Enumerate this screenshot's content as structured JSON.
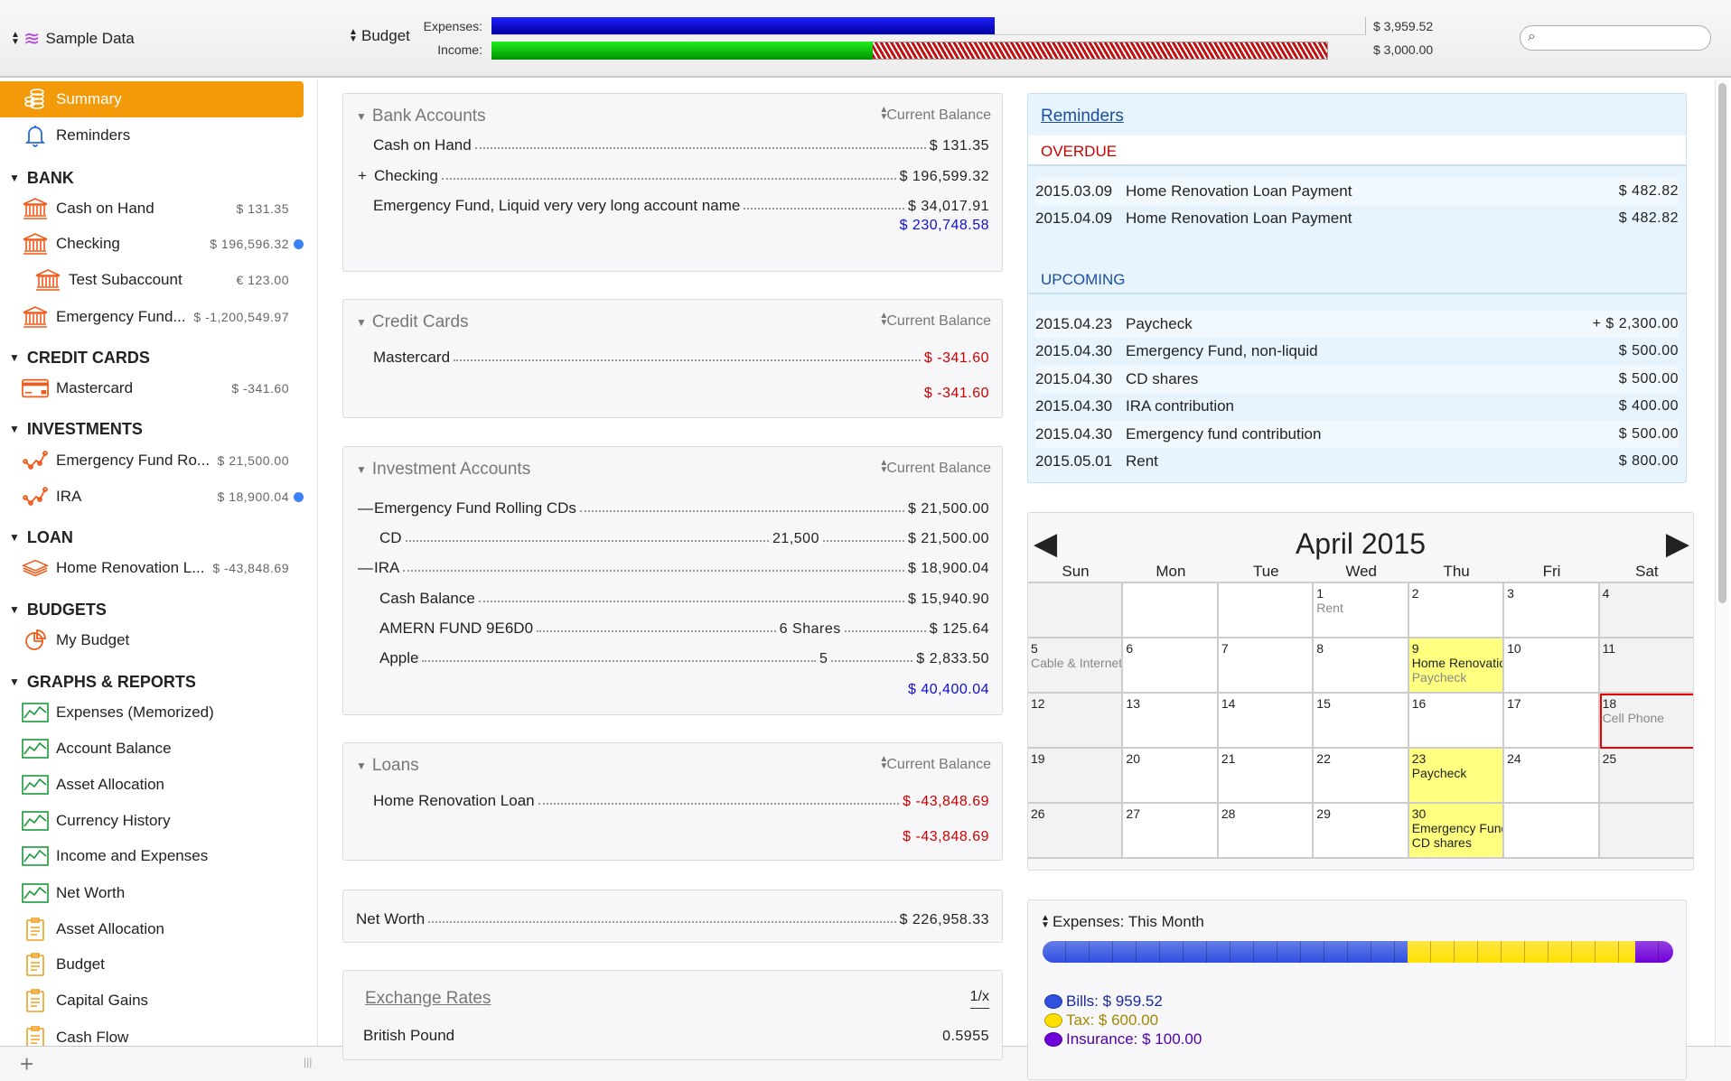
{
  "toolbar": {
    "document": "Sample Data",
    "budget": "Budget",
    "expenses_label": "Expenses:",
    "income_label": "Income:",
    "expenses_value": "$ 3,959.52",
    "income_value": "$ 3,000.00",
    "expenses_fill": 0.576,
    "income_received_fill": 0.436,
    "income_budget_fill": 0.957,
    "search_placeholder": ""
  },
  "colors": {
    "accent": "#f39a0a",
    "expenses_bar": "#0000d8",
    "income_bar": "#10c010",
    "income_remaining": "#c01010",
    "positive_total": "#1010d0",
    "negative": "#cc0000",
    "bills": "#3050e0",
    "tax": "#ffe000",
    "insurance": "#7000d8"
  },
  "sidebar": {
    "items": [
      {
        "label": "Summary",
        "icon": "coins-icon",
        "selected": true
      },
      {
        "label": "Reminders",
        "icon": "bell-icon"
      },
      {
        "label": "BANK",
        "header": true
      },
      {
        "label": "Cash on Hand",
        "icon": "bank-icon",
        "value": "$ 131.35"
      },
      {
        "label": "Checking",
        "icon": "bank-icon",
        "value": "$ 196,596.32",
        "dot": true
      },
      {
        "label": "Test Subaccount",
        "icon": "bank-icon",
        "value": "€ 123.00",
        "indent": true
      },
      {
        "label": "Emergency Fund...",
        "icon": "bank-icon",
        "value": "$ -1,200,549.97"
      },
      {
        "label": "CREDIT CARDS",
        "header": true
      },
      {
        "label": "Mastercard",
        "icon": "credit-card-icon",
        "value": "$ -341.60"
      },
      {
        "label": "INVESTMENTS",
        "header": true
      },
      {
        "label": "Emergency Fund Ro...",
        "icon": "investment-chart-icon",
        "value": "$ 21,500.00"
      },
      {
        "label": "IRA",
        "icon": "investment-chart-icon",
        "value": "$ 18,900.04",
        "dot": true
      },
      {
        "label": "LOAN",
        "header": true
      },
      {
        "label": "Home Renovation L...",
        "icon": "loan-stack-icon",
        "value": "$ -43,848.69"
      },
      {
        "label": "BUDGETS",
        "header": true
      },
      {
        "label": "My Budget",
        "icon": "budget-pie-icon"
      },
      {
        "label": "GRAPHS & REPORTS",
        "header": true
      },
      {
        "label": "Expenses (Memorized)",
        "icon": "graph-icon"
      },
      {
        "label": "Account Balance",
        "icon": "graph-icon"
      },
      {
        "label": "Asset Allocation",
        "icon": "graph-icon"
      },
      {
        "label": "Currency History",
        "icon": "graph-icon"
      },
      {
        "label": "Income and Expenses",
        "icon": "graph-icon"
      },
      {
        "label": "Net Worth",
        "icon": "graph-icon"
      },
      {
        "label": "Asset Allocation",
        "icon": "report-icon"
      },
      {
        "label": "Budget",
        "icon": "report-icon"
      },
      {
        "label": "Capital Gains",
        "icon": "report-icon"
      },
      {
        "label": "Cash Flow",
        "icon": "report-icon"
      }
    ]
  },
  "panels": {
    "bank": {
      "title": "Bank Accounts",
      "column": "Current Balance",
      "total": "$ 230,748.58",
      "rows": [
        {
          "name": "Cash on Hand",
          "value": "$ 131.35"
        },
        {
          "name": "Checking",
          "value": "$ 196,599.32",
          "prefix": "+"
        },
        {
          "name": "Emergency Fund, Liquid very very long account name",
          "value": "$ 34,017.91"
        }
      ]
    },
    "credit": {
      "title": "Credit Cards",
      "column": "Current Balance",
      "total": "$ -341.60",
      "rows": [
        {
          "name": "Mastercard",
          "value": "$ -341.60",
          "negative": true
        }
      ]
    },
    "investment": {
      "title": "Investment Accounts",
      "column": "Current Balance",
      "total": "$ 40,400.04",
      "rows": [
        {
          "name": "Emergency Fund Rolling CDs",
          "value": "$ 21,500.00",
          "prefix": "—"
        },
        {
          "name": "CD",
          "qty": "21,500",
          "value": "$ 21,500.00",
          "sub": true
        },
        {
          "name": "IRA",
          "value": "$ 18,900.04",
          "prefix": "—"
        },
        {
          "name": "Cash Balance",
          "value": "$ 15,940.90",
          "sub": true
        },
        {
          "name": "AMERN FUND 9E6D0",
          "qty": "6 Shares",
          "value": "$ 125.64",
          "sub": true
        },
        {
          "name": "Apple",
          "qty": "5",
          "value": "$ 2,833.50",
          "sub": true
        }
      ]
    },
    "loans": {
      "title": "Loans",
      "column": "Current Balance",
      "total": "$ -43,848.69",
      "rows": [
        {
          "name": "Home Renovation Loan",
          "value": "$ -43,848.69",
          "negative": true
        }
      ]
    },
    "networth": {
      "label": "Net Worth",
      "value": "$ 226,958.33"
    },
    "exchange": {
      "title": "Exchange Rates",
      "column": "1/x",
      "rows": [
        {
          "name": "British Pound",
          "value": "0.5955"
        }
      ]
    }
  },
  "reminders": {
    "title": "Reminders",
    "overdue_label": "OVERDUE",
    "upcoming_label": "UPCOMING",
    "overdue": [
      {
        "date": "2015.03.09",
        "name": "Home Renovation Loan Payment",
        "amount": "$ 482.82"
      },
      {
        "date": "2015.04.09",
        "name": "Home Renovation Loan Payment",
        "amount": "$ 482.82"
      }
    ],
    "upcoming": [
      {
        "date": "2015.04.23",
        "name": "Paycheck",
        "amount": "+ $ 2,300.00"
      },
      {
        "date": "2015.04.30",
        "name": "Emergency Fund, non-liquid",
        "amount": "$ 500.00"
      },
      {
        "date": "2015.04.30",
        "name": "CD shares",
        "amount": "$ 500.00"
      },
      {
        "date": "2015.04.30",
        "name": "IRA contribution",
        "amount": "$ 400.00"
      },
      {
        "date": "2015.04.30",
        "name": "Emergency fund contribution",
        "amount": "$ 500.00"
      },
      {
        "date": "2015.05.01",
        "name": "Rent",
        "amount": "$ 800.00"
      }
    ]
  },
  "calendar": {
    "title": "April 2015",
    "days_of_week": [
      "Sun",
      "Mon",
      "Tue",
      "Wed",
      "Thu",
      "Fri",
      "Sat"
    ],
    "cells": [
      {
        "day": ""
      },
      {
        "day": ""
      },
      {
        "day": ""
      },
      {
        "day": "1",
        "events": [
          {
            "text": "Rent",
            "gray": true
          }
        ]
      },
      {
        "day": "2"
      },
      {
        "day": "3"
      },
      {
        "day": "4"
      },
      {
        "day": "5",
        "events": [
          {
            "text": "Cable & Internet",
            "gray": true
          }
        ]
      },
      {
        "day": "6"
      },
      {
        "day": "7"
      },
      {
        "day": "8"
      },
      {
        "day": "9",
        "highlight": true,
        "events": [
          {
            "text": "Home Renovation"
          },
          {
            "text": "Paycheck",
            "gray": true
          }
        ]
      },
      {
        "day": "10"
      },
      {
        "day": "11"
      },
      {
        "day": "12"
      },
      {
        "day": "13"
      },
      {
        "day": "14"
      },
      {
        "day": "15"
      },
      {
        "day": "16"
      },
      {
        "day": "17"
      },
      {
        "day": "18",
        "today": true,
        "events": [
          {
            "text": "Cell Phone",
            "gray": true
          }
        ]
      },
      {
        "day": "19"
      },
      {
        "day": "20"
      },
      {
        "day": "21"
      },
      {
        "day": "22"
      },
      {
        "day": "23",
        "highlight": true,
        "events": [
          {
            "text": "Paycheck"
          }
        ]
      },
      {
        "day": "24"
      },
      {
        "day": "25"
      },
      {
        "day": "26"
      },
      {
        "day": "27"
      },
      {
        "day": "28"
      },
      {
        "day": "29"
      },
      {
        "day": "30",
        "highlight": true,
        "events": [
          {
            "text": "Emergency Fund"
          },
          {
            "text": "CD shares"
          }
        ]
      },
      {
        "day": ""
      },
      {
        "day": ""
      }
    ]
  },
  "expenses_month": {
    "title": "Expenses: This Month",
    "categories": [
      {
        "name": "Bills",
        "label": "Bills: $ 959.52",
        "value": 959.52,
        "color": "#3050e0",
        "text_color": "#1a2a9a"
      },
      {
        "name": "Tax",
        "label": "Tax: $ 600.00",
        "value": 600.0,
        "color": "#ffe000",
        "text_color": "#a08800"
      },
      {
        "name": "Insurance",
        "label": "Insurance: $ 100.00",
        "value": 100.0,
        "color": "#7000d8",
        "text_color": "#5000a0"
      }
    ]
  }
}
